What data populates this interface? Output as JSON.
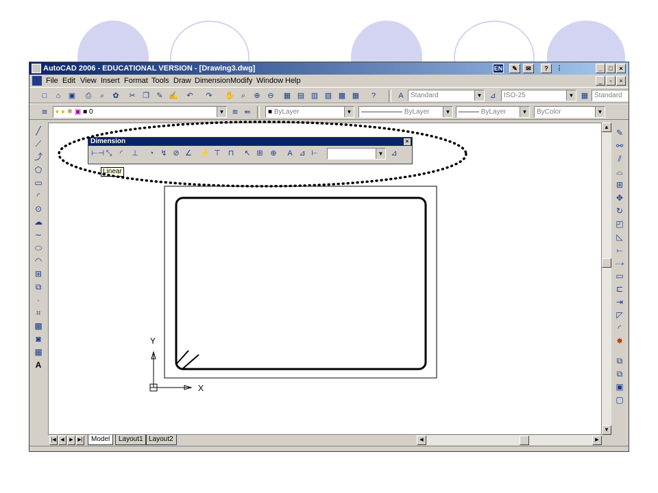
{
  "window": {
    "title": "AutoCAD 2006 - EDUCATIONAL VERSION - [Drawing3.dwg]",
    "lang_badge": "EN",
    "controls": [
      "_",
      "□",
      "×"
    ],
    "doc_controls": [
      "_",
      "▫",
      "×"
    ]
  },
  "menu": [
    "File",
    "Edit",
    "View",
    "Insert",
    "Format",
    "Tools",
    "Draw",
    "Dimension",
    "Modify",
    "Window",
    "Help"
  ],
  "styles_toolbar": {
    "text_style": "Standard",
    "dim_style": "ISO-25",
    "table_style": "Standard"
  },
  "layers_toolbar": {
    "layer": "0",
    "color": "ByLayer",
    "linetype": "ByLayer",
    "lineweight": "ByLayer",
    "plotstyle": "ByColor"
  },
  "dimension_toolbar": {
    "title": "Dimension",
    "tooltip": "Linear",
    "close": "×"
  },
  "ucs": {
    "y_label": "Y",
    "x_label": "X"
  },
  "tabs": [
    "Model",
    "Layout1",
    "Layout2"
  ],
  "colors": {
    "titlebar": "#0a246a",
    "highlight_ellipse": "#000000",
    "decor": "#d2d4f1"
  }
}
